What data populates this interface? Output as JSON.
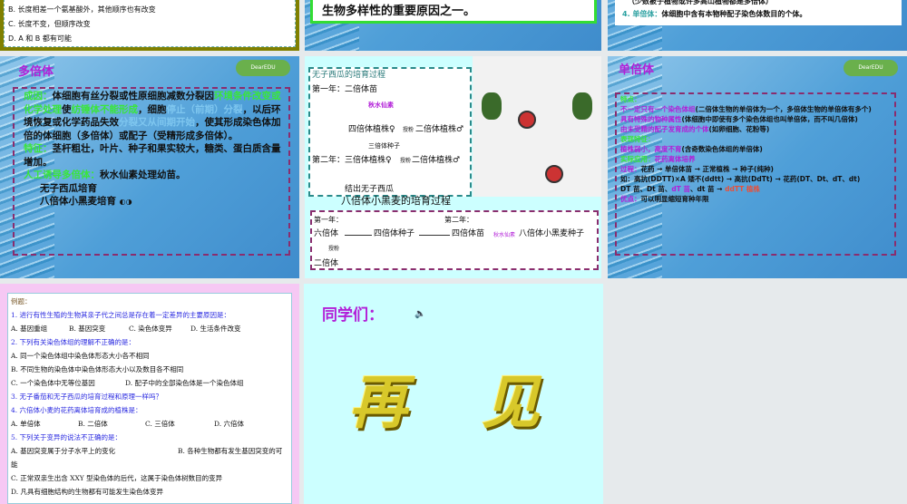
{
  "slides": {
    "s1": {
      "lines": [
        "B. 长度相差一个氨基酸外，其他顺序也有改变",
        "C. 长度不变，但顺序改变",
        "D. A 和 B 都有可能"
      ]
    },
    "s2": {
      "text": "生物多样性的重要原因之一。"
    },
    "s3": {
      "line1": "（少数被子植物或许多高山植物都是多倍体）",
      "line2_label": "4. 单倍体：",
      "line2": "体细胞中含有本物种配子染色体数目的个体。"
    },
    "s4": {
      "title": "多倍体",
      "cause_label": "成因：",
      "cause_a": "体细胞有丝分裂或性原细胞减数分裂因",
      "cause_b": "环境条件改变或化学处理",
      "cause_c": "使",
      "cause_d": "纺锤体不能形成",
      "cause_e": "，细胞",
      "cause_f": "停止（前期）分裂",
      "cause_g": "，以后环境恢复或化学药品失效",
      "cause_h": "分裂又从间期开始",
      "cause_i": "，使其形成染色体加倍的体细胞（多倍体）或配子（受精形成多倍体）。",
      "feat_label": "特征：",
      "feat": "茎杆粗壮，叶片、种子和果实较大，糖类、蛋白质含量增加。",
      "induce_label": "人工诱导多倍体：",
      "induce": "秋水仙素处理幼苗。",
      "item1": "无子西瓜培育",
      "item2": "八倍体小黑麦培育"
    },
    "s5": {
      "box1_title": "无子西瓜的培育过程",
      "y1": "第一年：二倍体苗",
      "colch": "秋水仙素",
      "tetra": "四倍体植株♀",
      "pollin": "授粉",
      "di": "二倍体植株♂",
      "seed": "三倍体种子",
      "y2": "第二年：三倍体植株♀",
      "pollin2": "授粉",
      "di2": "二倍体植株♂",
      "result": "结出无子西瓜",
      "box2_title": "八倍体小黑麦的培育过程",
      "b2y1": "第一年：",
      "b2y2": "第二年：",
      "hexa": "六倍体",
      "tseed": "四倍体种子",
      "tseedling": "四倍体苗",
      "colch2": "秋水仙素",
      "octo": "八倍体小黑麦种子",
      "pollin3": "授粉",
      "diploid": "二倍体"
    },
    "s6": {
      "title": "单倍体",
      "f_label": "特点：",
      "f1a": "不一定只有一个染色体组",
      "f1b": "(二倍体生物的单倍体为一个，多倍体生物的单倍体有多个)",
      "f2a": "具有特殊的物种属性",
      "f2b": "(体细胞中即使有多个染色体组也叫单倍体，而不叫几倍体)",
      "f3a": "由未受精的配子发育成的个体",
      "f3b": "(如卵细胞、花粉等)",
      "show_label": "表现特征：",
      "show_a": "植株弱小，高度不育",
      "show_b": "(含奇数染色体组的单倍体)",
      "app_label": "实际应用：",
      "app": "花药离体培养",
      "proc_label": "过程：",
      "proc": "花药 → 单倍体苗 → 正常植株 → 种子(纯种)",
      "ex": "如：高抗(DDTT)×A 矮不(ddtt) → 高抗(DdTt) → 花药(DT、Dt、dT、dt)",
      "ex2a": "DT 苗、Dt 苗、",
      "ex2b": "dT 苗",
      "ex2c": "、dt 苗 →",
      "ex2d": "ddTT 植株",
      "adv_label": "优点：",
      "adv": "可以明显缩短育种年限"
    },
    "s7": {
      "heading": "例题：",
      "q1": "1. 进行有性生殖的生物其亲子代之间总是存在着一定差异的主要原因是：",
      "q1o": [
        "A. 基因重组",
        "B. 基因突变",
        "C. 染色体变异",
        "D. 生活条件改变"
      ],
      "q2": "2. 下列有关染色体组的理解不正确的是：",
      "q2a": "A. 同一个染色体组中染色体形态大小各不相同",
      "q2b": "B. 不同生物的染色体中染色体形态大小以及数目各不相同",
      "q2c": "C. 一个染色体中无等位基因",
      "q2d": "D. 配子中的全部染色体是一个染色体组",
      "q3": "3. 无子番茄和无子西瓜的培育过程和原理一样吗？",
      "q4": "4. 六倍体小麦的花药离体培育成的植株是：",
      "q4o": [
        "A. 单倍体",
        "B. 二倍体",
        "C. 三倍体",
        "D. 六倍体"
      ],
      "q5": "5. 下列关于变异的说法不正确的是：",
      "q5a": "A. 基因突变属于分子水平上的变化",
      "q5b": "B. 各种生物都有发生基因突变的可能",
      "q5c": "C. 正常双亲生出含 XXY 型染色体的后代，这属于染色体树数目的变异",
      "q5d": "D. 凡具有细胞结构的生物都有可能发生染色体变异"
    },
    "s8": {
      "greet": "同学们：",
      "bye": "再 见"
    }
  }
}
